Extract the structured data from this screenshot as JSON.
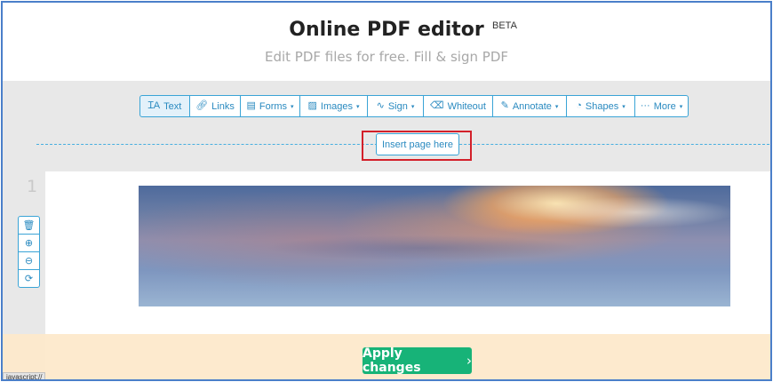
{
  "header": {
    "title": "Online PDF editor",
    "badge": "BETA",
    "subtitle": "Edit PDF files for free. Fill & sign PDF"
  },
  "toolbar": {
    "items": [
      {
        "label": "Text",
        "icon": "text-cursor-icon",
        "glyph": "ꞮA",
        "dropdown": false,
        "active": true
      },
      {
        "label": "Links",
        "icon": "link-icon",
        "glyph": "🔗︎",
        "dropdown": false
      },
      {
        "label": "Forms",
        "icon": "form-icon",
        "glyph": "▤",
        "dropdown": true
      },
      {
        "label": "Images",
        "icon": "image-icon",
        "glyph": "▨",
        "dropdown": true
      },
      {
        "label": "Sign",
        "icon": "signature-icon",
        "glyph": "∿",
        "dropdown": true
      },
      {
        "label": "Whiteout",
        "icon": "eraser-icon",
        "glyph": "⌫",
        "dropdown": false
      },
      {
        "label": "Annotate",
        "icon": "pen-icon",
        "glyph": "✎",
        "dropdown": true
      },
      {
        "label": "Shapes",
        "icon": "shapes-icon",
        "glyph": "◔",
        "dropdown": true
      },
      {
        "label": "More",
        "icon": "ellipsis-icon",
        "glyph": "···",
        "dropdown": true
      }
    ],
    "caret": "▾"
  },
  "insert_page": {
    "label": "Insert page here"
  },
  "page": {
    "number": "1",
    "tools": [
      {
        "name": "delete-page-icon",
        "glyph": "🗑︎"
      },
      {
        "name": "zoom-in-icon",
        "glyph": "⊕"
      },
      {
        "name": "zoom-out-icon",
        "glyph": "⊖"
      },
      {
        "name": "rotate-icon",
        "glyph": "⟳"
      }
    ]
  },
  "footer": {
    "apply_label": "Apply changes",
    "apply_chevron": "›"
  },
  "statusbar": {
    "text": "javascript://"
  },
  "colors": {
    "accent": "#2a8ac0",
    "apply": "#17b378",
    "highlight_box": "#d3202a",
    "footer_bg": "#fde9cc"
  }
}
